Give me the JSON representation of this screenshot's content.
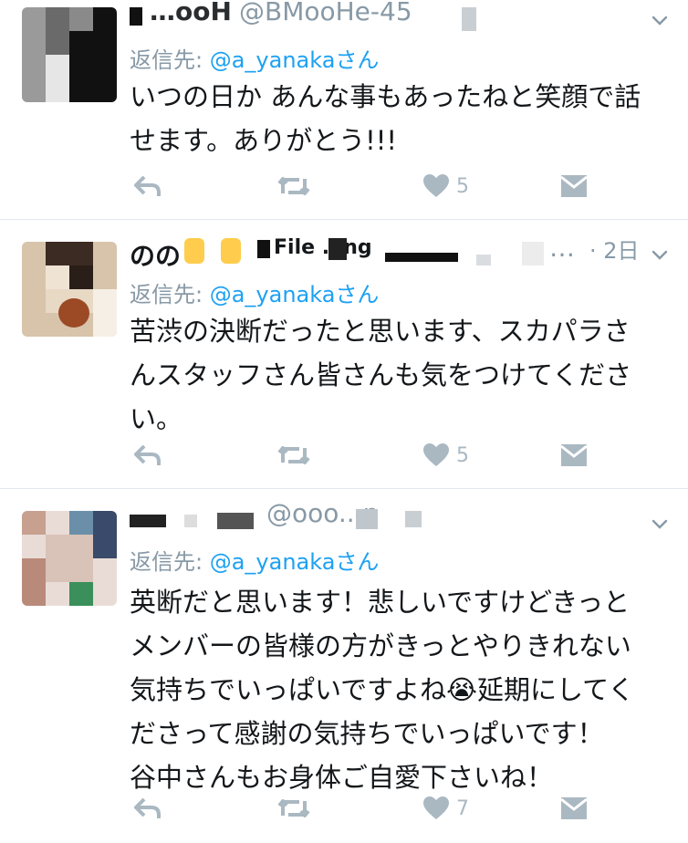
{
  "tweets": [
    {
      "name_partial": "…ooH",
      "handle_partial": "@BMooHe-45",
      "date": "",
      "reply_prefix": "返信先: ",
      "reply_handle": "@a_yanakaさん",
      "lines": [
        "いつの日か あんな事もあったねと笑顔で話",
        "せます。ありがとう!!!"
      ],
      "likes": "5",
      "avatar_colors": [
        "#1a1a1a",
        "#cfcfcf",
        "#6a6a6a",
        "#b0b0b0",
        "#ffffff"
      ]
    },
    {
      "name_partial": "のの",
      "name_tail": "File . ing",
      "handle_partial": "…",
      "date": "· 2日",
      "reply_prefix": "返信先: ",
      "reply_handle": "@a_yanakaさん",
      "lines": [
        "苦渋の決断だったと思います、スカパラさ",
        "んスタッフさん皆さんも気をつけてくださ",
        "い。"
      ],
      "likes": "5",
      "avatar_colors": [
        "#d7c4ab",
        "#3b2b22",
        "#b07a56",
        "#e8d9c5",
        "#7b3f24"
      ]
    },
    {
      "name_partial": "",
      "handle_partial": "@ooo...p",
      "date": "",
      "reply_prefix": "返信先: ",
      "reply_handle": "@a_yanakaさん",
      "lines": [
        "英断だと思います！悲しいですけどきっと",
        "メンバーの皆様の方がきっとやりきれない",
        "気持ちでいっぱいですよね😭延期にしてく",
        "ださって感謝の気持ちでいっぱいです！",
        "谷中さんもお身体ご自愛下さいね！"
      ],
      "likes": "7",
      "avatar_colors": [
        "#d9c2b8",
        "#6b8fa8",
        "#e9dcd6",
        "#3a4a6a",
        "#c7a08f"
      ]
    }
  ],
  "icons": {
    "reply": "reply-icon",
    "retweet": "retweet-icon",
    "like": "heart-icon",
    "dm": "envelope-icon",
    "menu": "chevron-down-icon"
  },
  "colors": {
    "accent": "#1da1f2",
    "muted": "#8899a6",
    "icon": "#aab8c2",
    "text": "#14171a",
    "divider": "#e1e8ed"
  }
}
